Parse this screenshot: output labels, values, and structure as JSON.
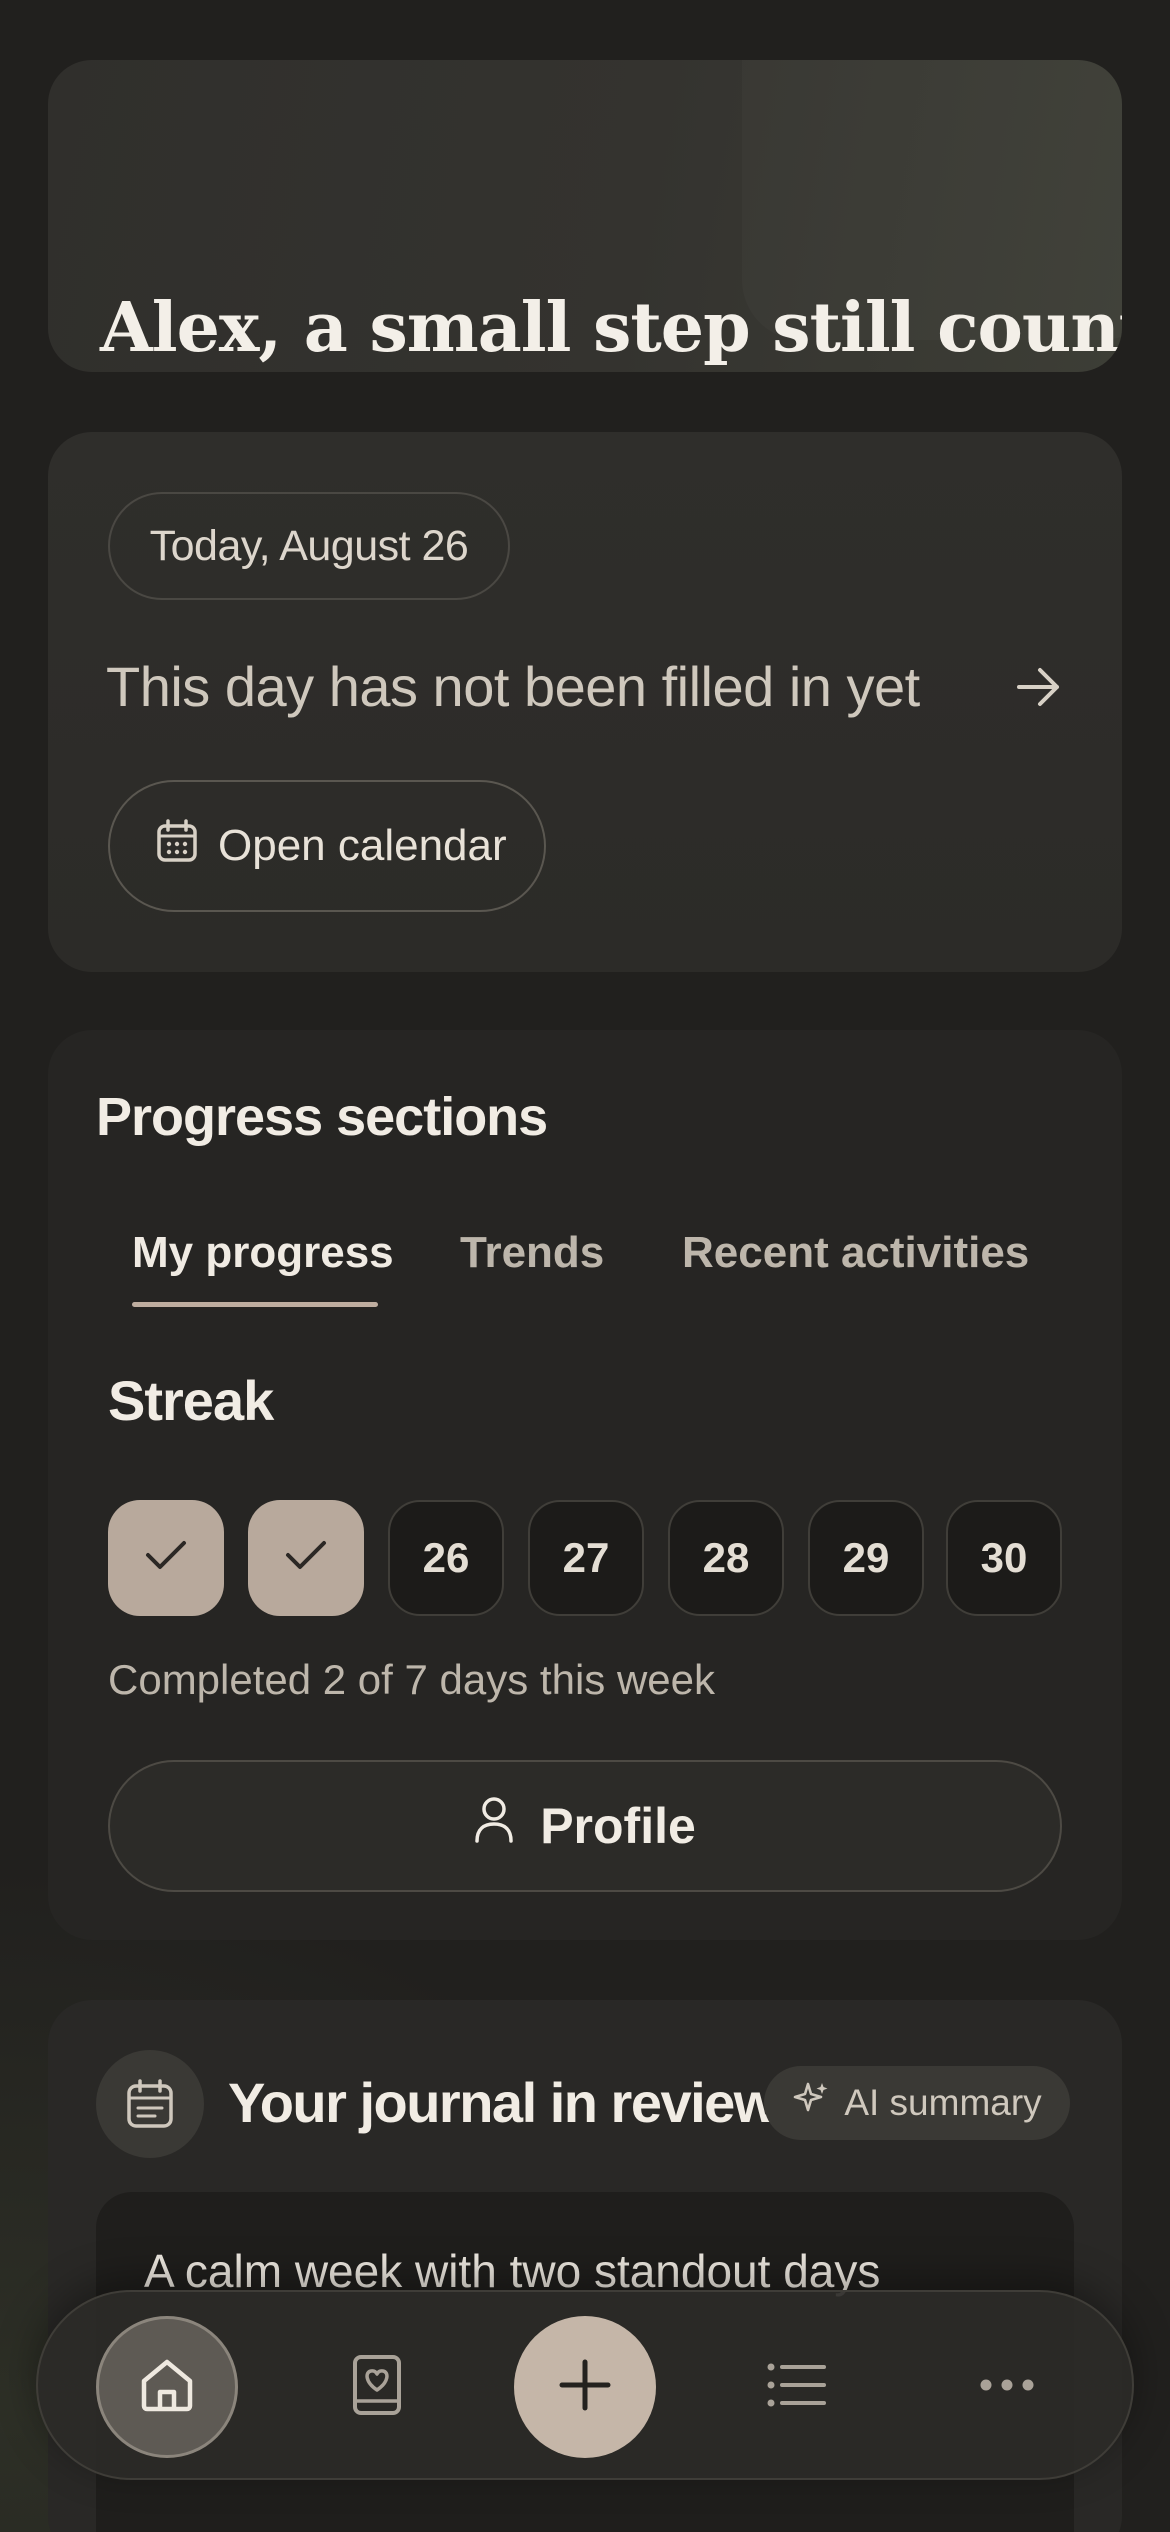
{
  "hero": {
    "greeting": "Alex, a small step still counts."
  },
  "today": {
    "date_label": "Today, August 26",
    "status_text": "This day has not been filled in yet",
    "open_calendar_label": "Open calendar"
  },
  "progress": {
    "title": "Progress sections",
    "tabs": [
      {
        "label": "My progress",
        "active": true
      },
      {
        "label": "Trends",
        "active": false
      },
      {
        "label": "Recent activities",
        "active": false
      }
    ],
    "streak_title": "Streak",
    "days": [
      {
        "label": "",
        "done": true
      },
      {
        "label": "",
        "done": true
      },
      {
        "label": "26",
        "done": false
      },
      {
        "label": "27",
        "done": false
      },
      {
        "label": "28",
        "done": false
      },
      {
        "label": "29",
        "done": false
      },
      {
        "label": "30",
        "done": false
      }
    ],
    "week_summary": "Completed 2 of 7 days this week",
    "profile_label": "Profile"
  },
  "journal": {
    "title": "Your journal in review",
    "ai_label": "AI summary",
    "headline": "A calm week with two standout days"
  },
  "nav": {
    "items": [
      "home-icon",
      "journal-heart-icon",
      "plus-icon",
      "list-icon",
      "more-icon"
    ]
  },
  "colors": {
    "accent": "#c5b6a8",
    "background": "#21201e",
    "card": "#2a2926"
  }
}
